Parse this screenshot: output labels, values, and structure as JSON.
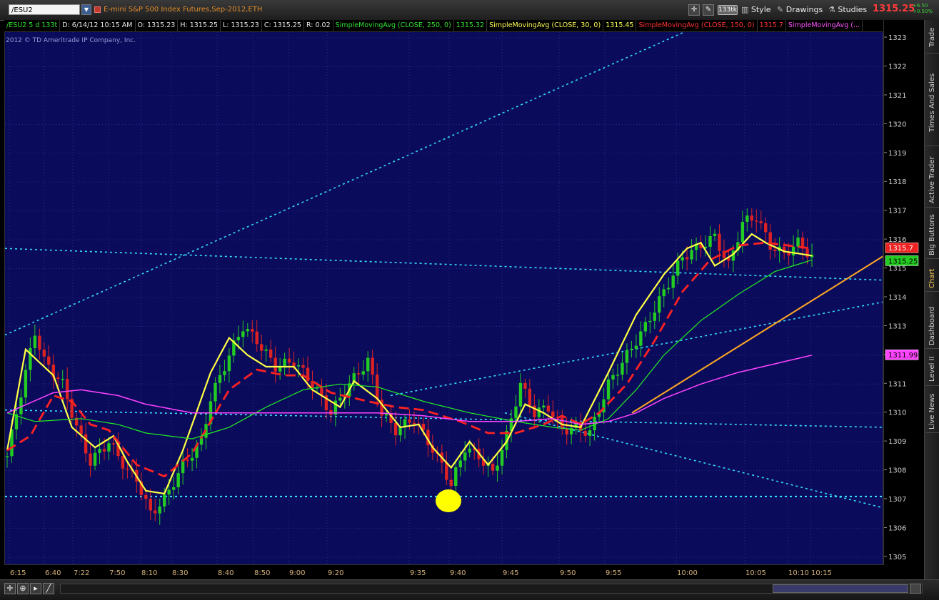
{
  "header": {
    "symbol": "/ESU2",
    "description": "E-mini S&P 500 Index Futures,Sep-2012,ETH",
    "tick_aggregation": "133tk",
    "style_label": "Style",
    "drawings_label": "Drawings",
    "studies_label": "Studies",
    "last_price": "1315.25",
    "net_change": "+6.50",
    "pct_change": "+0.50%"
  },
  "status_bar": {
    "symbol_period": "/ESU2 5 d 133t",
    "date": "D: 6/14/12 10:15 AM",
    "open": "O: 1315.23",
    "high": "H: 1315.25",
    "low": "L: 1315.23",
    "close": "C: 1315.25",
    "range": "R: 0.02",
    "sma250_label": "SimpleMovingAvg (CLOSE, 250, 0)",
    "sma250_value": "1315.32",
    "sma30_label": "SimpleMovingAvg (CLOSE, 30, 0)",
    "sma30_value": "1315.45",
    "sma150_label": "SimpleMovingAvg (CLOSE, 150, 0)",
    "sma150_value": "1315.7",
    "sma_m_label": "SimpleMovingAvg (..."
  },
  "copyright": "2012 © TD Ameritrade IP Company, Inc.",
  "right_nav": [
    "Trade",
    "Times And Sales",
    "Active Trader",
    "Big Buttons",
    "Chart",
    "Dashboard",
    "Level II",
    "Live News"
  ],
  "colors": {
    "background": "#0b0b5c",
    "up_bar": "#22cc22",
    "down_bar": "#dd2222",
    "sma30": "#ffff44",
    "sma150": "#ff2222",
    "sma250": "#22ee22",
    "sma_magenta": "#ff44ff",
    "trendline": "#33ddff",
    "drawn_line": "#ffaa22",
    "marker": "#ffff00"
  },
  "chart_data": {
    "type": "candlestick",
    "x_labels": [
      "6:15",
      "6:40",
      "7:22",
      "7:50",
      "8:10",
      "8:30",
      "8:40",
      "8:50",
      "9:00",
      "9:20",
      "9:35",
      "9:40",
      "9:45",
      "9:50",
      "9:55",
      "10:00",
      "10:05",
      "10:10",
      "10:15"
    ],
    "y_ticks": [
      1305,
      1306,
      1307,
      1308,
      1309,
      1310,
      1311,
      1312,
      1313,
      1314,
      1315,
      1316,
      1317,
      1318,
      1319,
      1320,
      1321,
      1322,
      1323
    ],
    "ylim": [
      1304.7,
      1323.2
    ],
    "price_anchors": [
      [
        0,
        1308.5
      ],
      [
        2,
        1310
      ],
      [
        6,
        1312.8
      ],
      [
        8,
        1311.8
      ],
      [
        12,
        1311
      ],
      [
        15,
        1309.5
      ],
      [
        18,
        1308.3
      ],
      [
        22,
        1309
      ],
      [
        26,
        1308
      ],
      [
        28,
        1307.7
      ],
      [
        31,
        1306.5
      ],
      [
        34,
        1307
      ],
      [
        38,
        1308.2
      ],
      [
        42,
        1309
      ],
      [
        44,
        1310.5
      ],
      [
        48,
        1312
      ],
      [
        51,
        1313
      ],
      [
        54,
        1312.5
      ],
      [
        58,
        1311.6
      ],
      [
        62,
        1311.8
      ],
      [
        66,
        1311
      ],
      [
        70,
        1310
      ],
      [
        74,
        1311
      ],
      [
        78,
        1311.8
      ],
      [
        81,
        1310
      ],
      [
        84,
        1309.4
      ],
      [
        88,
        1309.8
      ],
      [
        91,
        1309
      ],
      [
        94,
        1308.2
      ],
      [
        96,
        1307.5
      ],
      [
        99,
        1308.8
      ],
      [
        102,
        1308.5
      ],
      [
        105,
        1307.9
      ],
      [
        108,
        1309.2
      ],
      [
        111,
        1311
      ],
      [
        114,
        1310
      ],
      [
        117,
        1310.2
      ],
      [
        120,
        1309.4
      ],
      [
        123,
        1309.5
      ],
      [
        126,
        1309.3
      ],
      [
        130,
        1311
      ],
      [
        134,
        1312
      ],
      [
        138,
        1313
      ],
      [
        142,
        1314.2
      ],
      [
        146,
        1315.4
      ],
      [
        150,
        1315.8
      ],
      [
        153,
        1316.1
      ],
      [
        156,
        1315.1
      ],
      [
        159,
        1316.6
      ],
      [
        162,
        1316.8
      ],
      [
        165,
        1315.8
      ],
      [
        168,
        1315.5
      ],
      [
        171,
        1315.9
      ],
      [
        174,
        1315.4
      ]
    ],
    "series": [
      {
        "name": "SimpleMovingAvg (CLOSE, 30, 0)",
        "last": 1315.45,
        "anchors": [
          [
            0,
            1308.7
          ],
          [
            4,
            1312.2
          ],
          [
            10,
            1311.3
          ],
          [
            14,
            1309.5
          ],
          [
            19,
            1308.8
          ],
          [
            23,
            1309.2
          ],
          [
            26,
            1308.3
          ],
          [
            30,
            1307.3
          ],
          [
            34,
            1307.2
          ],
          [
            38,
            1308.7
          ],
          [
            44,
            1311.4
          ],
          [
            48,
            1312.6
          ],
          [
            52,
            1312
          ],
          [
            56,
            1311.6
          ],
          [
            62,
            1311.6
          ],
          [
            66,
            1310.8
          ],
          [
            72,
            1310.2
          ],
          [
            75,
            1311.1
          ],
          [
            80,
            1310.5
          ],
          [
            85,
            1309.5
          ],
          [
            89,
            1309.6
          ],
          [
            92,
            1308.8
          ],
          [
            96,
            1308.1
          ],
          [
            100,
            1309
          ],
          [
            104,
            1308.2
          ],
          [
            108,
            1309
          ],
          [
            112,
            1310.3
          ],
          [
            116,
            1310
          ],
          [
            120,
            1309.6
          ],
          [
            124,
            1309.5
          ],
          [
            130,
            1311.4
          ],
          [
            136,
            1313.4
          ],
          [
            142,
            1314.8
          ],
          [
            147,
            1315.7
          ],
          [
            150,
            1315.9
          ],
          [
            153,
            1315.1
          ],
          [
            157,
            1315.5
          ],
          [
            161,
            1316.2
          ],
          [
            164,
            1315.9
          ],
          [
            168,
            1315.6
          ],
          [
            174,
            1315.45
          ]
        ]
      },
      {
        "name": "SimpleMovingAvg (CLOSE, 150, 0)",
        "last": 1315.7,
        "anchors": [
          [
            0,
            1308.7
          ],
          [
            5,
            1309.2
          ],
          [
            10,
            1310.6
          ],
          [
            14,
            1310.4
          ],
          [
            18,
            1309.6
          ],
          [
            22,
            1309.4
          ],
          [
            28,
            1308.2
          ],
          [
            34,
            1307.8
          ],
          [
            40,
            1308.6
          ],
          [
            48,
            1310.8
          ],
          [
            54,
            1311.5
          ],
          [
            60,
            1311.3
          ],
          [
            64,
            1311.3
          ],
          [
            70,
            1310.7
          ],
          [
            78,
            1310.4
          ],
          [
            84,
            1310.2
          ],
          [
            90,
            1310.1
          ],
          [
            98,
            1309.7
          ],
          [
            104,
            1309.3
          ],
          [
            110,
            1309.3
          ],
          [
            116,
            1309.6
          ],
          [
            120,
            1309.9
          ],
          [
            124,
            1309.6
          ],
          [
            128,
            1310
          ],
          [
            134,
            1311
          ],
          [
            140,
            1312.5
          ],
          [
            146,
            1314.2
          ],
          [
            152,
            1315.3
          ],
          [
            158,
            1315.8
          ],
          [
            164,
            1315.9
          ],
          [
            174,
            1315.7
          ]
        ]
      },
      {
        "name": "SimpleMovingAvg (CLOSE, 250, 0)",
        "last": 1315.32,
        "anchors": [
          [
            0,
            1310
          ],
          [
            6,
            1309.7
          ],
          [
            16,
            1309.8
          ],
          [
            24,
            1309.6
          ],
          [
            30,
            1309.3
          ],
          [
            40,
            1309.1
          ],
          [
            48,
            1309.5
          ],
          [
            56,
            1310.2
          ],
          [
            64,
            1310.8
          ],
          [
            72,
            1311
          ],
          [
            80,
            1310.9
          ],
          [
            90,
            1310.4
          ],
          [
            100,
            1310
          ],
          [
            110,
            1309.7
          ],
          [
            118,
            1309.5
          ],
          [
            124,
            1309.4
          ],
          [
            130,
            1309.8
          ],
          [
            136,
            1310.8
          ],
          [
            142,
            1312
          ],
          [
            150,
            1313.2
          ],
          [
            158,
            1314.1
          ],
          [
            166,
            1314.9
          ],
          [
            174,
            1315.3
          ]
        ]
      },
      {
        "name": "SimpleMovingAvg (...",
        "last": 1311.99,
        "anchors": [
          [
            0,
            1310
          ],
          [
            10,
            1310.7
          ],
          [
            16,
            1310.8
          ],
          [
            24,
            1310.6
          ],
          [
            30,
            1310.3
          ],
          [
            40,
            1310
          ],
          [
            50,
            1310
          ],
          [
            60,
            1310
          ],
          [
            70,
            1310
          ],
          [
            80,
            1310
          ],
          [
            90,
            1309.9
          ],
          [
            100,
            1309.7
          ],
          [
            110,
            1309.7
          ],
          [
            118,
            1309.8
          ],
          [
            124,
            1309.6
          ],
          [
            130,
            1309.7
          ],
          [
            136,
            1310
          ],
          [
            142,
            1310.5
          ],
          [
            150,
            1311
          ],
          [
            158,
            1311.4
          ],
          [
            166,
            1311.7
          ],
          [
            174,
            1312
          ]
        ]
      }
    ],
    "price_labels": [
      {
        "value": "1315.7",
        "price": 1315.7,
        "bg": "#ee2222",
        "fg": "#ffffff"
      },
      {
        "value": "1315.25",
        "price": 1315.25,
        "bg": "#22cc22",
        "fg": "#000000"
      },
      {
        "value": "1311.99",
        "price": 1311.99,
        "bg": "#ff44ff",
        "fg": "#000000"
      }
    ],
    "bar_count": 175
  }
}
